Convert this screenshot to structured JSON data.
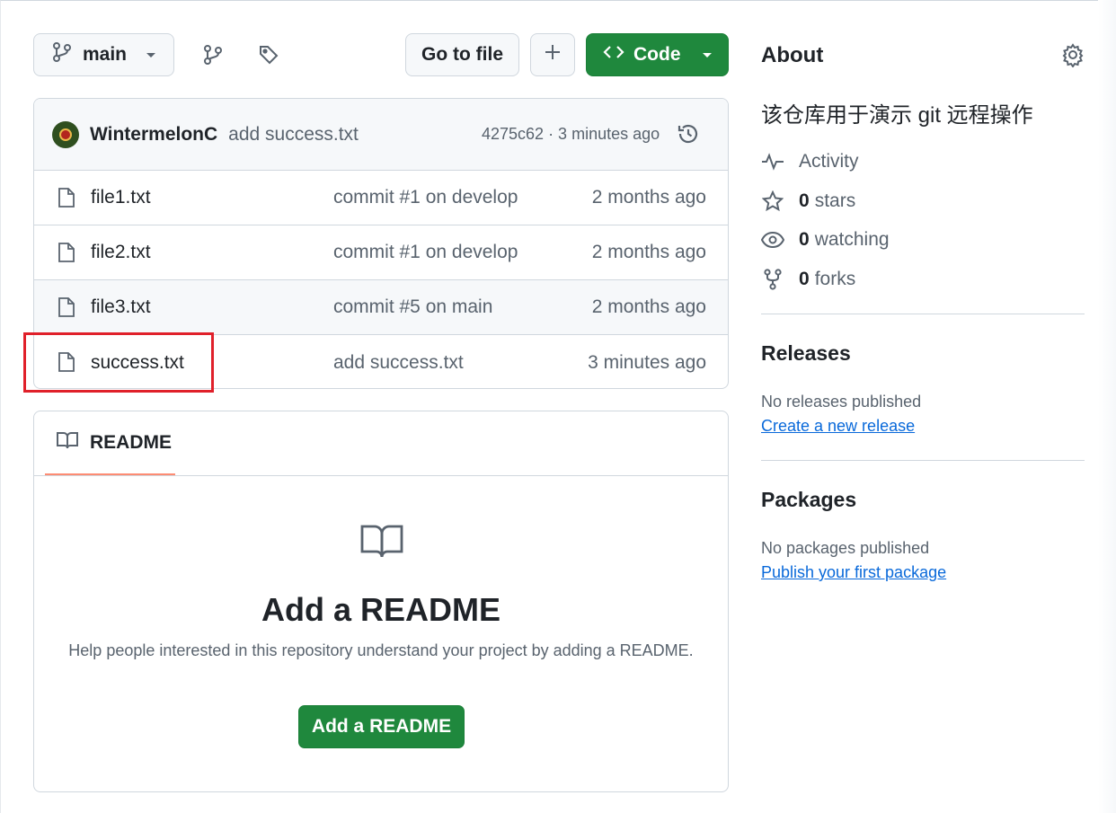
{
  "toolbar": {
    "branch_label": "main",
    "goto_label": "Go to file",
    "code_label": "Code"
  },
  "latest_commit": {
    "author": "WintermelonC",
    "message": "add success.txt",
    "meta": "4275c62 · 3 minutes ago"
  },
  "files": [
    {
      "name": "file1.txt",
      "commit": "commit #1 on develop",
      "time": "2 months ago"
    },
    {
      "name": "file2.txt",
      "commit": "commit #1 on develop",
      "time": "2 months ago"
    },
    {
      "name": "file3.txt",
      "commit": "commit #5 on main",
      "time": "2 months ago"
    },
    {
      "name": "success.txt",
      "commit": "add success.txt",
      "time": "3 minutes ago"
    }
  ],
  "readme": {
    "tab_label": "README",
    "title": "Add a README",
    "description": "Help people interested in this repository understand your project by adding a README.",
    "button_label": "Add a README"
  },
  "about": {
    "title": "About",
    "description": "该仓库用于演示 git 远程操作",
    "activity_label": "Activity",
    "stars_count": "0",
    "stars_label": "stars",
    "watching_count": "0",
    "watching_label": "watching",
    "forks_count": "0",
    "forks_label": "forks"
  },
  "releases": {
    "title": "Releases",
    "note": "No releases published",
    "link": "Create a new release"
  },
  "packages": {
    "title": "Packages",
    "note": "No packages published",
    "link": "Publish your first package"
  },
  "colors": {
    "primary_green": "#1f883d",
    "link_blue": "#0969da",
    "highlight_red": "#e0202a",
    "tab_underline": "#fd8c73"
  }
}
